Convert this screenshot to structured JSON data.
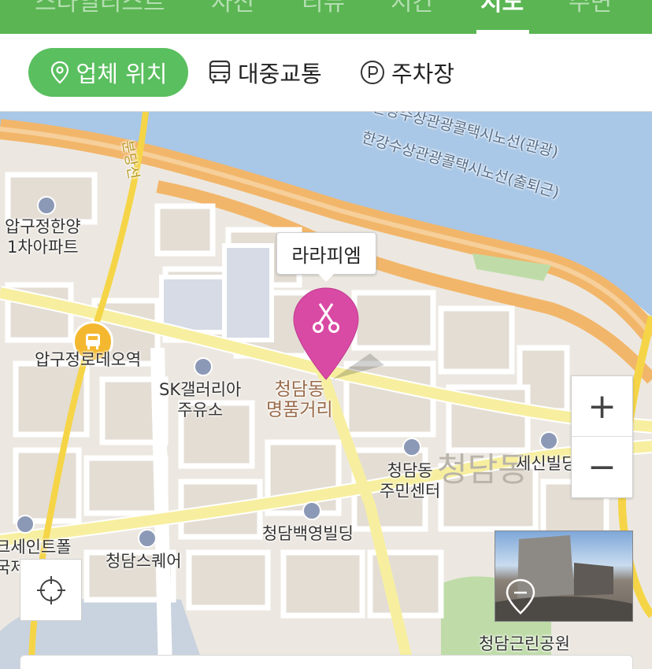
{
  "top_tabs": [
    {
      "label": "스타일리스트"
    },
    {
      "label": "사진"
    },
    {
      "label": "리뷰"
    },
    {
      "label": "시간"
    },
    {
      "label": "지도"
    },
    {
      "label": "주변"
    }
  ],
  "location_tabs": [
    {
      "label": "업체 위치",
      "icon": "location-pin-icon",
      "active": true
    },
    {
      "label": "대중교통",
      "icon": "bus-icon",
      "active": false
    },
    {
      "label": "주차장",
      "icon": "parking-icon",
      "active": false
    }
  ],
  "map": {
    "business_marker_label": "라라피엠",
    "labels": {
      "river_route_1": "한강수상관광콜택시노선(관광)",
      "river_route_2": "한강수상관광콜택시노선(출퇴근)",
      "river_route_top": "한강수상관광콜택시노선",
      "subway_line": "분당선",
      "apt": "압구정한양\n1차아파트",
      "station": "압구정로데오역",
      "gas_station": "SK갤러리아\n주유소",
      "luxury_street": "청담동\n명품거리",
      "community_center": "청담동\n주민센터",
      "district": "청담동",
      "sesin": "세신빌딩",
      "baekyoung": "청담백영빌딩",
      "square": "청담스퀘어",
      "school": "크세인트폴\n국제학교",
      "park": "청담근린공원"
    },
    "zoom_in_label": "+",
    "zoom_out_label": "−"
  },
  "colors": {
    "header_green": "#5ab552",
    "pill_green": "#5abf5f",
    "marker_pink": "#d94aa5",
    "river_blue": "#a9c7e6",
    "road_orange": "#f2b66a",
    "subway_yellow": "#f5d547"
  }
}
